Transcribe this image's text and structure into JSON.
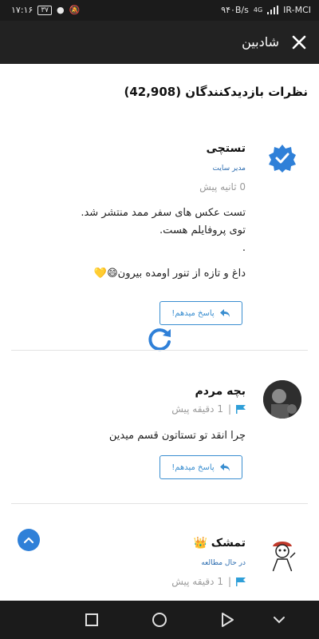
{
  "status_bar": {
    "time": "۱۷:۱۶",
    "battery": "۳۷",
    "speed": "۹۴۰B/s",
    "network": "4G",
    "carrier": "IR-MCI"
  },
  "app_bar": {
    "title": "شادبین"
  },
  "section_title": "نظرات بازدیدکنندگان (42,908)",
  "comments": [
    {
      "name": "تستچی",
      "role": "مدیر سایت",
      "time": "0 ثانیه پیش",
      "lines": [
        "تست عکس های سفر ممد منتشر شد.",
        "توی پروفایلم هست.",
        ".",
        "",
        "داغ و تازه از تنور اومده بیرون😄💛"
      ],
      "reply_label": "پاسخ میدهم!"
    },
    {
      "name": "بچه مردم",
      "time": "1 دقیقه پیش",
      "separator": "|",
      "lines": [
        "چرا انقد تو تستاتون قسم میدین"
      ],
      "reply_label": "پاسخ میدهم!"
    },
    {
      "name": "تمشک 👑",
      "role": "در حال مطالعه",
      "time": "1 دقیقه پیش",
      "separator": "|"
    }
  ],
  "colors": {
    "accent": "#2f80d8",
    "app_bar": "#222222",
    "verified": "#2f80d8"
  }
}
